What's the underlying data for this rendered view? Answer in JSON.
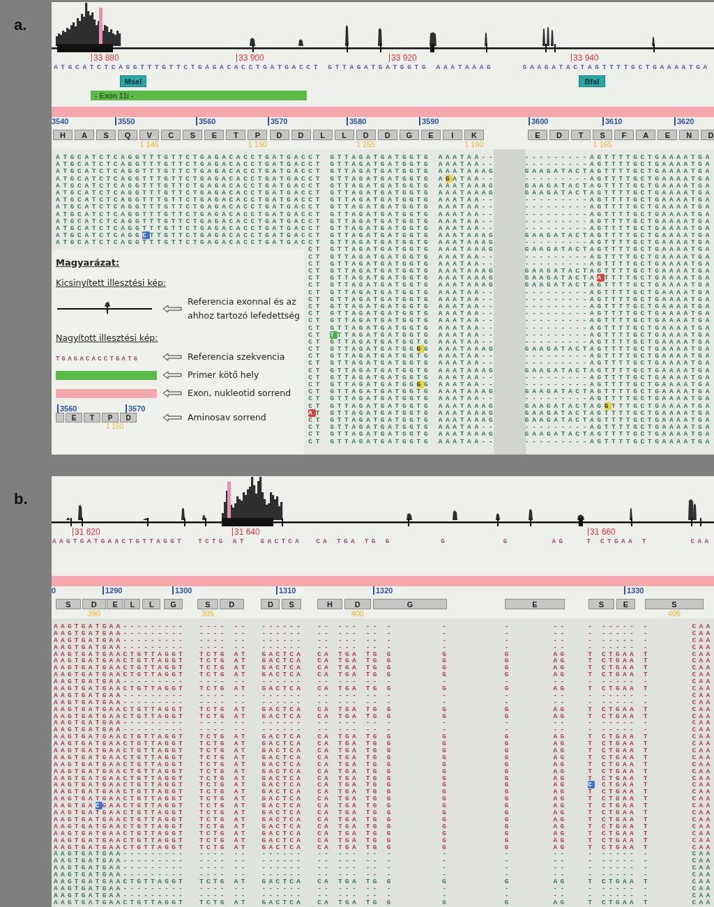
{
  "panels": [
    {
      "label": "a.",
      "positions": [
        "33 880",
        "33 900",
        "33 920",
        "33 940"
      ],
      "reference": "ATGCATCTCAGGTTTGTTCTGAGACACCTGATGACCT GTTAGATGATGGTG AAATAAAG    GAAGATACTAGTTTTGCTGAAAATGA",
      "enzymes": [
        {
          "name": "MseI"
        },
        {
          "name": "BfaI"
        }
      ],
      "primer": {
        "label": "- Exon 11i -"
      },
      "ruler": [
        "3540",
        "3550",
        "3560",
        "3570",
        "3580",
        "3590",
        "3600",
        "3610",
        "3620"
      ],
      "amino_acids": [
        [
          {
            "letter": "H"
          },
          {
            "letter": "A"
          },
          {
            "letter": "S"
          },
          {
            "letter": "Q"
          },
          {
            "letter": "V",
            "number": "1 145"
          },
          {
            "letter": "C"
          },
          {
            "letter": "S"
          },
          {
            "letter": "E"
          },
          {
            "letter": "T"
          },
          {
            "letter": "P",
            "number": "1 150"
          },
          {
            "letter": "D"
          },
          {
            "letter": "D"
          },
          {
            "letter": "L"
          },
          {
            "letter": "L"
          },
          {
            "letter": "D",
            "number": "1 155"
          },
          {
            "letter": "D"
          },
          {
            "letter": "G"
          },
          {
            "letter": "E"
          },
          {
            "letter": "I"
          },
          {
            "letter": "K",
            "number": "1 160"
          }
        ],
        [
          {
            "letter": "E"
          },
          {
            "letter": "D"
          },
          {
            "letter": "T"
          },
          {
            "letter": "S",
            "number": "1 165"
          },
          {
            "letter": "F"
          },
          {
            "letter": "A"
          },
          {
            "letter": "E"
          },
          {
            "letter": "N"
          },
          {
            "letter": "D"
          }
        ]
      ],
      "reads": [
        {
          "reverse": false,
          "text": "ATGCATCTCAGGTTTGTTCTGAGACACCTGATGACCT GTTAGATGATGGTG AAATAA--    ---------AGTTTTGCTGAAAATGA"
        },
        {
          "reverse": false,
          "text": "ATGCATCTCAGGTTTGTTCTGAGACACCTGATGACCT GTTAGATGATGGTG AAATAA--    ---------AGTTTTGCTGAAAATGA"
        },
        {
          "reverse": false,
          "text": "ATGCATCTCAGGTTTGTTCTGAGACACCTGATGACCT GTTAGATGATGGTG AAATAAAG    GAAGATACTAGTTTTGCTGAAAATGA"
        },
        {
          "reverse": false,
          "segments": [
            {
              "text": "ATGCATCTCAGGTTTGTTCTGAGACACCTGATGACCT GTTAGATGATGGTG A"
            },
            {
              "kind": "mismatch",
              "text": "G",
              "color": "#e6d23c"
            },
            {
              "text": "ATAA--    ---------AGTTTTGCTGAAAATGA"
            }
          ]
        },
        {
          "reverse": false,
          "text": "ATGCATCTCAGGTTTGTTCTGAGACACCTGATGACCT GTTAGATGATGGTG AAATAAAG    GAAGATACTAGTTTTGCTGAAAATGA"
        },
        {
          "reverse": false,
          "text": "ATGCATCTCAGGTTTGTTCTGAGACACCTGATGACCT GTTAGATGATGGTG AAATAAAG    GAAGATACTAGTTTTGCTGAAAATGA"
        },
        {
          "reverse": false,
          "text": "ATGCATCTCAGGTTTGTTCTGAGACACCTGATGACCT GTTAGATGATGGTG AAATAA--    ---------AGTTTTGCTGAAAATGA"
        },
        {
          "reverse": false,
          "text": "ATGCATCTCAGGTTTGTTCTGAGACACCTGATGACCT GTTAGATGATGGTG AAATAA--    ---------AGTTTTGCTGAAAATGA"
        },
        {
          "reverse": false,
          "text": "ATGCATCTCAGGTTTGTTCTGAGACACCTGATGACCT GTTAGATGATGGTG AAATAA--    ---------AGTTTTGCTGAAAATGA"
        },
        {
          "reverse": false,
          "text": "ATGCATCTCAGGTTTGTTCTGAGACACCTGATGACCT GTTAGATGATGGTG AAATAA--    ---------AGTTTTGCTGAAAATGA"
        },
        {
          "reverse": false,
          "text": "ATGCATCTCAGGTTTGTTCTGAGACACCTGATGACCT GTTAGATGATGGTG AAATAA--    ---------AGTTTTGCTGAAAATGA"
        },
        {
          "reverse": false,
          "segments": [
            {
              "text": "ATGCATCTCAGG"
            },
            {
              "kind": "mismatch",
              "text": "C",
              "color": "#3f6fd1"
            },
            {
              "text": "TTGTTCTGAGACACCTGATGACCT GTTAGATGATGGTG AAATAAAG    GAAGATACTAGTTTTGCTGAAAATGA"
            }
          ]
        },
        {
          "reverse": false,
          "text": "ATGCATCTCAGGTTTGTTCTGAGACACCTGATGACCT GTTAGATGATGGTG AAATAAAG    ---------AGTTTTGCTGAAAATGA"
        },
        {
          "reverse": false,
          "text": "CT GTTAGATGATGGTG AAATAAAG    GAAGATACTAGTTTTGCTGAAAATGA"
        },
        {
          "reverse": false,
          "text": "CT GTTAGATGATGGTG AAATAA--    ---------AGTTTTGCTGAAAATGA"
        },
        {
          "reverse": false,
          "text": "CT GTTAGATGATGGTG AAATAA--    ---------AGTTTTGCTGAAAATGA"
        },
        {
          "reverse": false,
          "text": "CT GTTAGATGATGGTG AAATAAAG    GAAGATACTAGTTTTGCTGAAAATGA"
        },
        {
          "reverse": false,
          "segments": [
            {
              "text": "CT GTTAGATGATGGTG AAATAAAG    GAAGATACTA"
            },
            {
              "kind": "mismatch",
              "text": "A",
              "color": "#d9413f"
            },
            {
              "text": "TTTTGCTGAAAATGA"
            }
          ]
        },
        {
          "reverse": false,
          "text": "CT GTTAGATGATGGTG AAATAAAG    GAAGATACTAGTTTTGCTGAAAATGA"
        },
        {
          "reverse": false,
          "text": "CT GTTAGATGATGGTG AAATAA--    ---------AGTTTTGCTGAAAATGA"
        },
        {
          "reverse": false,
          "text": "CT GTTAGATGATGGTG AAATAA--    ---------AGTTTTGCTGAAAATGA"
        },
        {
          "reverse": false,
          "text": "CT GTTAGATGATGGTG AAATAA--    ---------AGTTTTGCTGAAAATGA"
        },
        {
          "reverse": false,
          "text": "CT GTTAGATGATGGTG AAATAA--    ---------AGTTTTGCTGAAAATGA"
        },
        {
          "reverse": false,
          "text": "CT GTTAGATGATGGTG AAATAA--    ---------AGTTTTGCTGAAAATGA"
        },
        {
          "reverse": false,
          "text": "CT GTTAGATGATGGTG AAATAA--    ---------AGTTTTGCTGAAAATGA"
        },
        {
          "reverse": false,
          "segments": [
            {
              "text": "CT "
            },
            {
              "kind": "mismatch",
              "text": "T",
              "color": "#4caf50"
            },
            {
              "text": "TTAGATGATGGTG AAATAA--    ---------AGTTTTGCTGAAAATGA"
            }
          ]
        },
        {
          "reverse": false,
          "text": "CT GTTAGATGATGGTG AAATAA--    ---------AGTTTTGCTGAAAATGA"
        },
        {
          "reverse": false,
          "segments": [
            {
              "text": "CT GTTAGATGATGG"
            },
            {
              "kind": "mismatch",
              "text": "G",
              "color": "#e6d23c"
            },
            {
              "text": "G AAATAAAG    GAAGATACTAGTTTTGCTGAAAATGA"
            }
          ]
        },
        {
          "reverse": false,
          "text": "CT GTTAGATGATGGTG AAATAA--    ---------AGTTTTGCTGAAAATGA"
        },
        {
          "reverse": false,
          "text": "CT GTTAGATGATGGTG AAATAA--    ---------AGTTTTGCTGAAAATGA"
        },
        {
          "reverse": false,
          "text": "CT GTTAGATGATGGTG AAATAAAG    GAAGATACTAGTTTTGCTGAAAATGA"
        },
        {
          "reverse": false,
          "text": "CT GTTAGATGATGGTG AAATAA--    ---------AGTTTTGCTGAAAATGA"
        },
        {
          "reverse": false,
          "segments": [
            {
              "text": "CT GTTAGATGATGG"
            },
            {
              "kind": "mismatch",
              "text": "G",
              "color": "#e6d23c"
            },
            {
              "text": "G AAATAA--    ---------AGTTTTGCTGAAAATGA"
            }
          ]
        },
        {
          "reverse": false,
          "text": "CT GTTAGATGATGGTG AAATAAAG    GAAGATACTAGTTTTGCTGAAAATGA"
        },
        {
          "reverse": false,
          "text": "CT GTTAGATGATGGTG AAATAA--    ---------AGTTTTGCTGAAAATGA"
        },
        {
          "reverse": false,
          "segments": [
            {
              "text": "CT GTTAGATGATGGTG AAATAAAG    GAAGATACTAG"
            },
            {
              "kind": "mismatch",
              "text": "G",
              "color": "#e6d23c"
            },
            {
              "text": "TTTGCTGAAAATGA"
            }
          ]
        },
        {
          "reverse": false,
          "segments": [
            {
              "kind": "mismatch",
              "text": "A",
              "color": "#d9413f"
            },
            {
              "text": "T GTTAGATGATGGTG AAATAAAG    GAAGATACTAGTTTTGCTGAAAATGA"
            }
          ]
        },
        {
          "reverse": false,
          "text": "CT GTTAGATGATGGTG AAATAAAG    GAAGATACTAGTTTTGCTGAAAATGA"
        },
        {
          "reverse": false,
          "text": "CT GTTAGATGATGGTG AAATAA--    ---------AGTTTTGCTGAAAATGA"
        },
        {
          "reverse": false,
          "text": "CT GTTAGATGATGGTG AAATAAAG    GAAGATACTAGTTTTGCTGAAAATGA"
        },
        {
          "reverse": false,
          "text": "CT GTTAGATGATGGTG AAATAA--    ---------AGTTTTGCTGAAAATGA"
        }
      ]
    },
    {
      "label": "b.",
      "positions": [
        "31 620",
        "31 640",
        "31 660"
      ],
      "reference": "AAGTGATGAACTGTTAGGT  TCTG AT  GACTCA  CA TGA TG G       G        G      AG   T CTGAA T      CAA",
      "ruler": [
        "0",
        "1290",
        "1300",
        "1310",
        "1320",
        "1330"
      ],
      "amino_acids": [
        [
          {
            "letter": "S"
          },
          {
            "letter": "D",
            "number": "390"
          },
          {
            "letter": "E"
          },
          {
            "letter": "L"
          },
          {
            "letter": "L"
          },
          {
            "letter": "G"
          },
          {
            "letter": "S",
            "number": "395"
          },
          {
            "letter": "D"
          },
          {
            "letter": "D"
          },
          {
            "letter": "S"
          },
          {
            "letter": "H"
          },
          {
            "letter": "D",
            "number": "400"
          },
          {
            "letter": "G"
          },
          {
            "letter": "E"
          },
          {
            "letter": "S"
          },
          {
            "letter": "E"
          },
          {
            "letter": "S",
            "number": "405"
          }
        ]
      ],
      "reads": [
        {
          "reverse": true,
          "text": "AAGTGATGAA---------  ---- --  ------  -- --- -- -       -        -      --   - ----- -      CAA"
        },
        {
          "reverse": true,
          "text": "AAGTGATGAA---------  ---- --  ------  -- --- -- -       -        -      --   - ----- -      CAA"
        },
        {
          "reverse": true,
          "text": "AAGTGATGAA---------  ---- --  ------  -- --- -- -       -        -      --   - ----- -      CAA"
        },
        {
          "reverse": true,
          "text": "AAGTGATGAA---------  ---- --  ------  -- --- -- -       -        -      --   - ----- -      CAA"
        },
        {
          "reverse": true,
          "text": "AAGTGATGAACTGTTAGGT  TCTG AT  GACTCA  CA TGA TG G       G        G      AG   T CTGAA T      CAA"
        },
        {
          "reverse": true,
          "text": "AAGTGATGAACTGTTAGGT  TCTG AT  GACTCA  CA TGA TG G       G        G      AG   T CTGAA T      CAA"
        },
        {
          "reverse": true,
          "text": "AAGTGATGAACTGTTAGGT  TCTG AT  GACTCA  CA TGA TG G       G        G      AG   T CTGAA T      CAA"
        },
        {
          "reverse": true,
          "text": "AAGTGATGAACTGTTAGGT  TCTG AT  GACTCA  CA TGA TG G       G        G      AG   T CTGAA T      CAA"
        },
        {
          "reverse": true,
          "text": "AAGTGATGAA---------  ---- --  ------  -- --- -- -       -        -      --   - ----- -      CAA"
        },
        {
          "reverse": true,
          "text": "AAGTGATGAACTGTTAGGT  TCTG AT  GACTCA  CA TGA TG G       G        G      AG   T CTGAA T      CAA"
        },
        {
          "reverse": true,
          "text": "AAGTGATGAA---------  ---- --  ------  -- --- -- -       -        -      --   - ----- -      CAA"
        },
        {
          "reverse": true,
          "text": "AAGTGATGAA---------  ---- --  ------  -- --- -- -       -        -      --   - ----- -      CAA"
        },
        {
          "reverse": true,
          "text": "AAGTGATGAACTGTTAGGT  TCTG AT  GACTCA  CA TGA TG G       G        G      AG   T CTGAA T      CAA"
        },
        {
          "reverse": true,
          "text": "AAGTGATGAACTGTTAGGT  TCTG AT  GACTCA  CA TGA TG G       G        G      AG   T CTGAA T      CAA"
        },
        {
          "reverse": true,
          "text": "AAGTGATGAA---------  ---- --  ------  -- --- -- -       -        -      --   - ----- -      CAA"
        },
        {
          "reverse": true,
          "text": "AAGTGATGAA---------  ---- --  ------  -- --- -- -       -        -      --   - ----- -      CAA"
        },
        {
          "reverse": true,
          "text": "AAGTGATGAACTGTTAGGT  TCTG AT  GACTCA  CA TGA TG G       G        G      AG   T CTGAA T      CAA"
        },
        {
          "reverse": true,
          "text": "AAGTGATGAACTGTTAGGT  TCTG AT  GACTCA  CA TGA TG G       G        G      AG   T CTGAA T      CAA"
        },
        {
          "reverse": true,
          "text": "AAGTGATGAACTGTTAGGT  TCTG AT  GACTCA  CA TGA TG G       G        G      AG   T CTGAA T      CAA"
        },
        {
          "reverse": true,
          "text": "AAGTGATGAACTGTTAGGT  TCTG AT  GACTCA  CA TGA TG G       G        G      AG   T CTGAA T      CAA"
        },
        {
          "reverse": true,
          "text": "AAGTGATGAACTGTTAGGT  TCTG AT  GACTCA  CA TGA TG G       G        G      AG   T CTGAA T      CAA"
        },
        {
          "reverse": true,
          "text": "AAGTGATGAACTGTTAGGT  TCTG AT  GACTCA  CA TGA TG G       G        G      AG   T CTGAA T      CAA"
        },
        {
          "reverse": true,
          "text": "AAGTGATGAACTGTTAGGT  TCTG AT  GACTCA  CA TGA TG G       G        G      AG   T CTGAA T      CAA"
        },
        {
          "reverse": true,
          "segments": [
            {
              "text": "AAGTGATGAACTGTTAGGT  TCTG AT  GACTCA  CA TGA TG G       G        G      AG   "
            },
            {
              "kind": "mismatch",
              "text": "C",
              "color": "#3f6fd1"
            },
            {
              "text": " CTGAA T      CAA"
            }
          ]
        },
        {
          "reverse": true,
          "text": "AAGTGATGAACTGTTAGGT  TCTG AT  GACTCA  CA TGA TG G       G        G      AG   T CTGAA T      CAA"
        },
        {
          "reverse": true,
          "text": "AAGTGATGAACTGTTAGGT  TCTG AT  GACTCA  CA TGA TG G       G        G      AG   T CTGAA T      CAA"
        },
        {
          "reverse": true,
          "segments": [
            {
              "text": "AAGTGA"
            },
            {
              "kind": "mismatch",
              "text": "C",
              "color": "#3f6fd1"
            },
            {
              "text": "GAACTGTTAGGT  TCTG AT  GACTCA  CA TGA TG G       G        G      AG   T CTGAA T      CAA"
            }
          ]
        },
        {
          "reverse": true,
          "text": "AAGTGATGAACTGTTAGGT  TCTG AT  GACTCA  CA TGA TG G       G        G      AG   T CTGAA T      CAA"
        },
        {
          "reverse": true,
          "text": "AAGTGATGAACTGTTAGGT  TCTG AT  GACTCA  CA TGA TG G       G        G      AG   T CTGAA T      CAA"
        },
        {
          "reverse": true,
          "text": "AAGTGATGAACTGTTAGGT  TCTG AT  GACTCA  CA TGA TG G       G        G      AG   T CTGAA T      CAA"
        },
        {
          "reverse": true,
          "text": "AAGTGATGAACTGTTAGGT  TCTG AT  GACTCA  CA TGA TG G       G        G      AG   T CTGAA T      CAA"
        },
        {
          "reverse": true,
          "text": "AAGTGATGAACTGTTAGGT  TCTG AT  GACTCA  CA TGA TG G       G        G      AG   T CTGAA T      CAA"
        },
        {
          "reverse": true,
          "text": "AAGTGATGAACTGTTAGGT  TCTG AT  GACTCA  CA TGA TG G       G        G      AG   T CTGAA T      CAA"
        },
        {
          "reverse": false,
          "text": "AAGTGATGAA---------  ---- --  ------  -- --- -- -       -        -      --   - ----- -      CAA"
        },
        {
          "reverse": false,
          "text": "AAGTGATGAA---------  ---- --  ------  -- --- -- -       -        -      --   - ----- -      CAA"
        },
        {
          "reverse": false,
          "text": "AAGTGATGAA---------  ---- --  ------  -- --- -- -       -        -      --   - ----- -      CAA"
        },
        {
          "reverse": false,
          "text": "AAGTGATGAA---------  ---- --  ------  -- --- -- -       -        -      --   - ----- -      CAA"
        },
        {
          "reverse": false,
          "text": "AAGTGATGAACTGTTAGGT  TCTG AT  GACTCA  CA TGA TG G       G        G      AG   T CTGAA T      CAA"
        },
        {
          "reverse": false,
          "text": "AAGTGATGAA---------  ---- --  ------  -- --- -- -       -        -      --   - ----- -      CAA"
        },
        {
          "reverse": false,
          "text": "AAGTGATGAA---------  ---- --  ------  -- --- -- -       -        -      --   - ----- -      CAA"
        },
        {
          "reverse": false,
          "text": "AAGTGATGAACTGTTAGGT  TCTG AT  GACTCA  CA TGA TG G       G        G      AG   T CTGAA T      CAA"
        }
      ]
    }
  ],
  "legend": {
    "title": "Magyarázat:",
    "sections": [
      {
        "heading": "Kicsinyített illesztési kép:",
        "items": [
          {
            "kind": "coverage",
            "label": "Referencia exonnal és az ahhoz tartozó lefedettség"
          }
        ]
      },
      {
        "heading": "Nagyított illesztési kép:",
        "items": [
          {
            "kind": "sequence",
            "sequence": "TGAGACACCTGATG",
            "label": "Referencia szekvencia"
          },
          {
            "kind": "primer",
            "label": "Primer kötő hely"
          },
          {
            "kind": "exon",
            "label": "Exon, nukleotid sorrend"
          },
          {
            "kind": "amino",
            "ruler": [
              "3560",
              "3570"
            ],
            "residues": [
              "E",
              "T",
              "P",
              "D"
            ],
            "number": "1 150",
            "label": "Aminosav sorrend"
          }
        ]
      }
    ]
  }
}
